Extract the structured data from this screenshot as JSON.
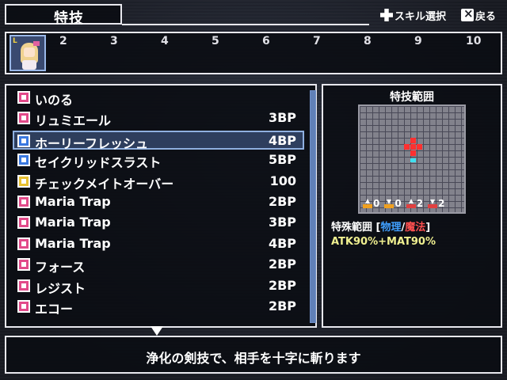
{
  "header": {
    "title": "特技",
    "hint_skill_select": "スキル選択",
    "hint_back": "戻る"
  },
  "party": {
    "leader_tag": "L",
    "slots": [
      "2",
      "3",
      "4",
      "5",
      "6",
      "7",
      "8",
      "9",
      "10"
    ]
  },
  "skills": [
    {
      "name": "いのる",
      "cost": "",
      "icon": "pray-icon",
      "icon_color": "#e24a8a"
    },
    {
      "name": "リュミエール",
      "cost": "3BP",
      "icon": "magic-icon",
      "icon_color": "#e24a8a"
    },
    {
      "name": "ホーリーフレッシュ",
      "cost": "4BP",
      "icon": "magic-icon",
      "icon_color": "#3a78e0",
      "selected": true
    },
    {
      "name": "セイクリッドスラスト",
      "cost": "5BP",
      "icon": "magic-icon",
      "icon_color": "#3a78e0"
    },
    {
      "name": "チェックメイトオーバー",
      "cost": "100",
      "icon": "special-icon",
      "icon_color": "#e8c030"
    },
    {
      "name": "Maria Trap",
      "cost": "2BP",
      "icon": "trap-icon",
      "icon_color": "#e24a8a"
    },
    {
      "name": "Maria Trap",
      "cost": "3BP",
      "icon": "trap-icon",
      "icon_color": "#e24a8a"
    },
    {
      "name": "Maria Trap",
      "cost": "4BP",
      "icon": "trap-icon",
      "icon_color": "#e24a8a"
    },
    {
      "name": "フォース",
      "cost": "2BP",
      "icon": "voice-icon",
      "icon_color": "#e24a8a"
    },
    {
      "name": "レジスト",
      "cost": "2BP",
      "icon": "voice-icon",
      "icon_color": "#e24a8a"
    },
    {
      "name": "エコー",
      "cost": "2BP",
      "icon": "voice-icon",
      "icon_color": "#e24a8a"
    }
  ],
  "range": {
    "title": "特技範囲",
    "stats": [
      {
        "dir": "up",
        "value": "0"
      },
      {
        "dir": "down",
        "value": "0"
      },
      {
        "dir": "up",
        "value": "2"
      },
      {
        "dir": "down",
        "value": "2"
      }
    ],
    "type_label": "特殊範囲",
    "bracket_open": " [",
    "physical": "物理",
    "slash": "/",
    "magical": "魔法",
    "bracket_close": "]",
    "formula": "ATK90%+MAT90%",
    "colors": {
      "physical": "#40a0ff",
      "magical": "#ff5050"
    }
  },
  "description": "浄化の剣技で、相手を十字に斬ります"
}
